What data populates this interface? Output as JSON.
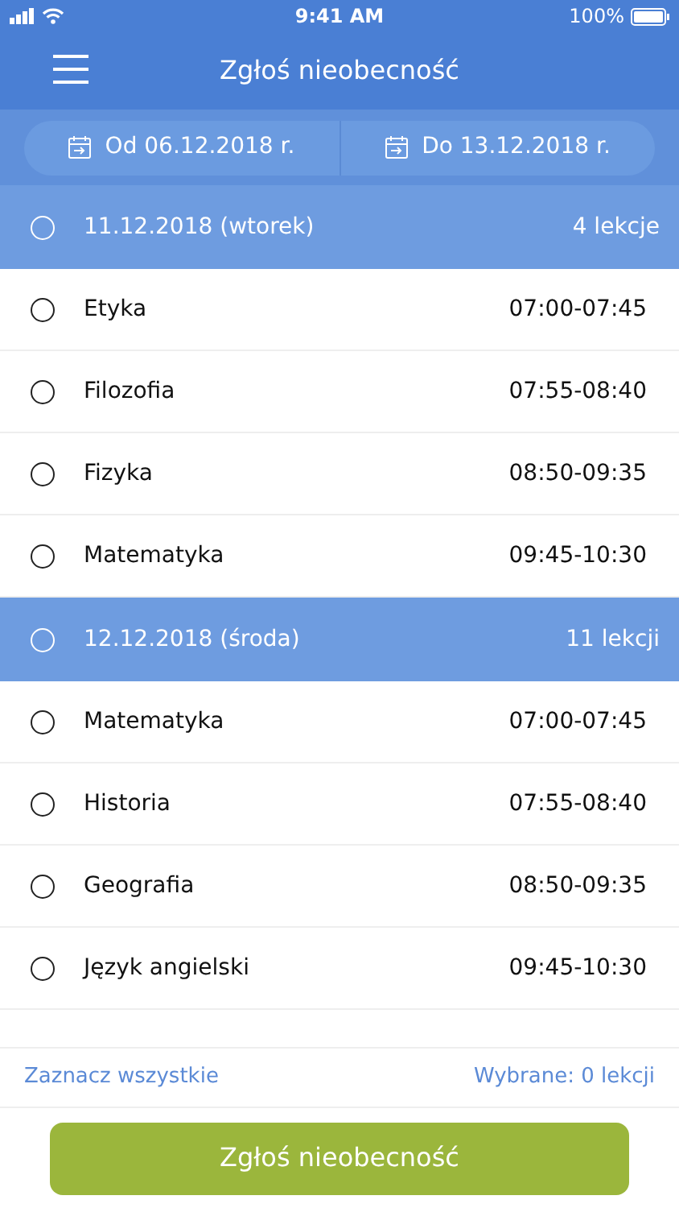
{
  "status_bar": {
    "time": "9:41 AM",
    "battery": "100%"
  },
  "header": {
    "title": "Zgłoś nieobecność"
  },
  "date_range": [
    {
      "label": "Od 06.12.2018 r."
    },
    {
      "label": "Do 13.12.2018 r."
    }
  ],
  "days": [
    {
      "date": "11.12.2018 (wtorek)",
      "count": "4 lekcje",
      "checked": false,
      "lessons": [
        {
          "subject": "Etyka",
          "time": "07:00-07:45",
          "checked": false
        },
        {
          "subject": "Filozofia",
          "time": "07:55-08:40",
          "checked": false
        },
        {
          "subject": "Fizyka",
          "time": "08:50-09:35",
          "checked": false
        },
        {
          "subject": "Matematyka",
          "time": "09:45-10:30",
          "checked": false
        }
      ]
    },
    {
      "date": "12.12.2018 (środa)",
      "count": "11 lekcji",
      "checked": false,
      "lessons": [
        {
          "subject": "Matematyka",
          "time": "07:00-07:45",
          "checked": false
        },
        {
          "subject": "Historia",
          "time": "07:55-08:40",
          "checked": false
        },
        {
          "subject": "Geografia",
          "time": "08:50-09:35",
          "checked": false
        },
        {
          "subject": "Język angielski",
          "time": "09:45-10:30",
          "checked": false
        }
      ]
    }
  ],
  "footer": {
    "select_all": "Zaznacz wszystkie",
    "selected": "Wybrane: 0 lekcji"
  },
  "submit_button": "Zgłoś nieobecność"
}
